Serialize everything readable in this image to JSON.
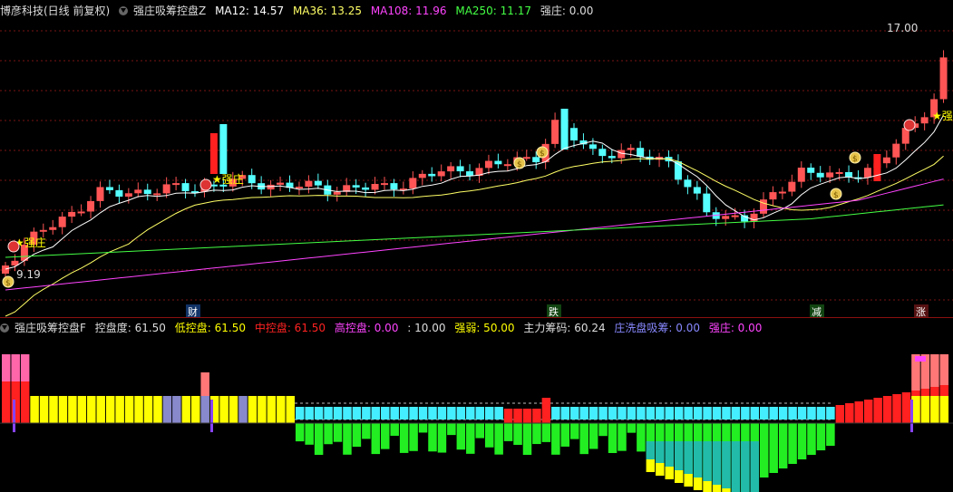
{
  "top": {
    "security": "博彦科技(日线 前复权)",
    "formula": "强庄吸筹控盘Z",
    "items": [
      {
        "label": "MA12: 14.57",
        "color": "#ffffff"
      },
      {
        "label": "MA36: 13.25",
        "color": "#ffff66"
      },
      {
        "label": "MA108: 11.96",
        "color": "#ff44ff"
      },
      {
        "label": "MA250: 11.17",
        "color": "#44ff44"
      },
      {
        "label": "强庄: 0.00",
        "color": "#dddddd"
      }
    ]
  },
  "bottom": {
    "formula": "强庄吸筹控盘F",
    "items": [
      {
        "label": "控盘度: 61.50",
        "color": "#dddddd"
      },
      {
        "label": "低控盘: 61.50",
        "color": "#ffff00"
      },
      {
        "label": "中控盘: 61.50",
        "color": "#ff2222"
      },
      {
        "label": "高控盘: 0.00",
        "color": "#ff44ff"
      },
      {
        "label": ": 10.00",
        "color": "#dddddd"
      },
      {
        "label": "强弱: 50.00",
        "color": "#ffff00"
      },
      {
        "label": "主力筹码: 60.24",
        "color": "#dddddd"
      },
      {
        "label": "庄洗盘吸筹: 0.00",
        "color": "#8888ff"
      },
      {
        "label": "强庄: 0.00",
        "color": "#ff44ff"
      }
    ]
  },
  "annotations": {
    "price_high": "17.00",
    "price_low": "9.19",
    "strong_label": "★强庄",
    "events": [
      "财",
      "跌",
      "减",
      "涨"
    ]
  },
  "colors": {
    "up": "#ff5555",
    "down": "#55ffff",
    "red": "#ff2020"
  }
}
